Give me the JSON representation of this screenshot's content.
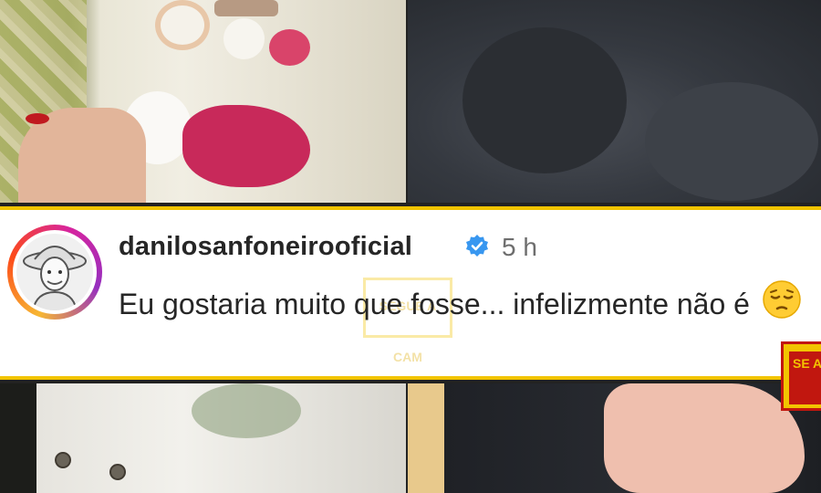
{
  "comment": {
    "username": "danilosanfoneirooficial",
    "timestamp": "5 h",
    "text": "Eu gostaria muito que fosse... infelizmente não é",
    "emoji": "pensive-face"
  },
  "watermark_text": "SEGUE A CAM",
  "logo_text": "SE A",
  "colors": {
    "frame_yellow": "#f2c400",
    "verified_blue": "#3897f0",
    "logo_red": "#c1170f"
  },
  "icons": [
    "verified-badge-icon",
    "pensive-face-icon",
    "avatar-illustration"
  ]
}
